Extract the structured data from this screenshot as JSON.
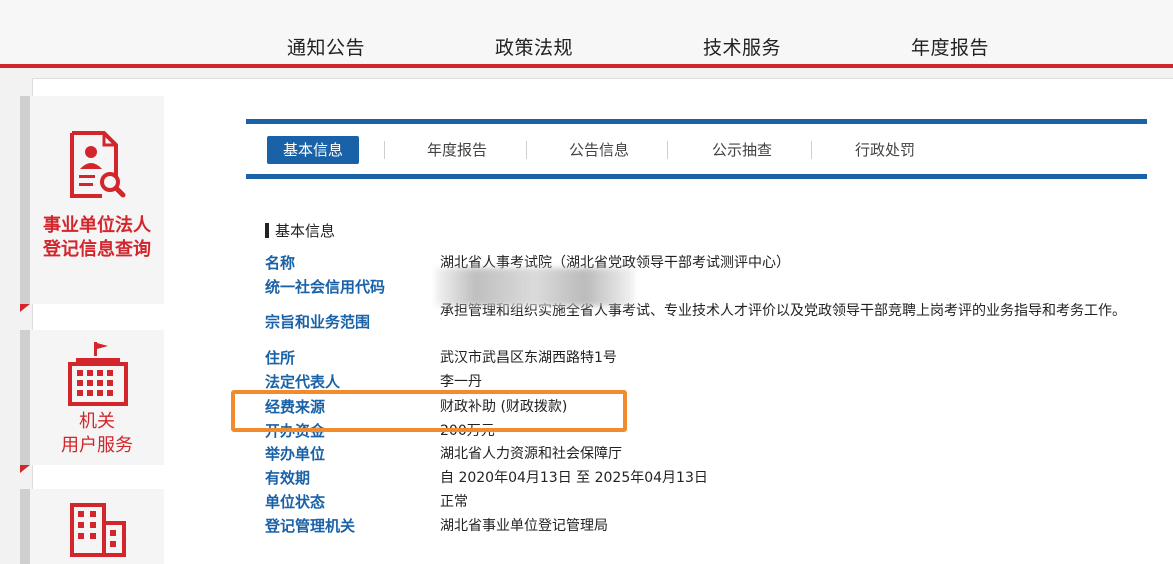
{
  "topnav": {
    "items": [
      "通知公告",
      "政策法规",
      "技术服务",
      "年度报告"
    ]
  },
  "sidebar": {
    "cards": [
      {
        "label_line1": "事业单位法人",
        "label_line2": "登记信息查询",
        "icon": "id-card-search-icon"
      },
      {
        "label_line1": "机关",
        "label_line2": "用户服务",
        "icon": "government-building-icon"
      },
      {
        "label_line1": "",
        "label_line2": "",
        "icon": "office-building-icon"
      }
    ]
  },
  "tabs": [
    "基本信息",
    "年度报告",
    "公告信息",
    "公示抽查",
    "行政处罚"
  ],
  "section": {
    "title": "基本信息"
  },
  "fields": [
    {
      "key": "名称",
      "value": "湖北省人事考试院（湖北省党政领导干部考试测评中心）"
    },
    {
      "key": "统一社会信用代码",
      "value": ""
    },
    {
      "key": "宗旨和业务范围",
      "value": "承担管理和组织实施全省人事考试、专业技术人才评价以及党政领导干部竞聘上岗考评的业务指导和考务工作。"
    },
    {
      "key": "住所",
      "value": "武汉市武昌区东湖西路特1号"
    },
    {
      "key": "法定代表人",
      "value": "李一丹"
    },
    {
      "key": "经费来源",
      "value": "财政补助 (财政拨款)"
    },
    {
      "key": "开办资金",
      "value": "200万元"
    },
    {
      "key": "举办单位",
      "value": "湖北省人力资源和社会保障厅"
    },
    {
      "key": "有效期",
      "value": "自 2020年04月13日 至 2025年04月13日"
    },
    {
      "key": "单位状态",
      "value": "正常"
    },
    {
      "key": "登记管理机关",
      "value": "湖北省事业单位登记管理局"
    }
  ],
  "colors": {
    "brand_red": "#d2262c",
    "tab_blue": "#1a62a8",
    "highlight_orange": "#f28a2e"
  }
}
